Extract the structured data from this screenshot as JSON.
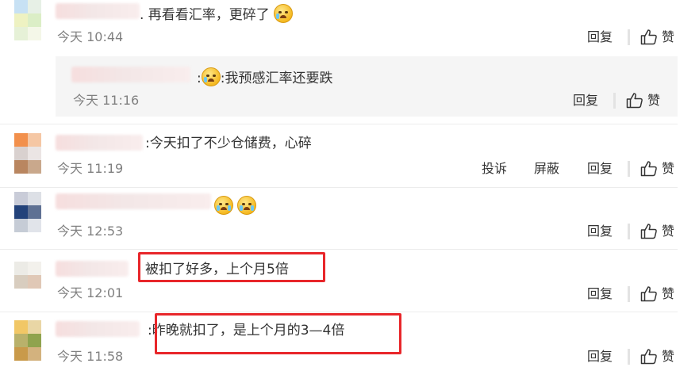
{
  "comments": [
    {
      "text": ". 再看看汇率，更碎了",
      "time": "今天 10:44",
      "reply": "回复",
      "like": "赞"
    },
    {
      "text": ":我预感汇率还要跌",
      "time": "今天 11:16",
      "reply": "回复",
      "like": "赞"
    },
    {
      "text": "今天扣了不少仓储费，心碎",
      "time": "今天 11:19",
      "report": "投诉",
      "block": "屏蔽",
      "reply": "回复",
      "like": "赞"
    },
    {
      "text": "",
      "time": "今天 12:53",
      "reply": "回复",
      "like": "赞"
    },
    {
      "text": "被扣了好多，上个月5倍",
      "time": "今天 12:01",
      "reply": "回复",
      "like": "赞"
    },
    {
      "text": ":昨晚就扣了，是上个月的3—4倍",
      "time": "今天 11:58",
      "reply": "回复",
      "like": "赞"
    }
  ],
  "colors": {
    "highlight": "#e8262a",
    "time": "#808080",
    "reply_bg": "#f5f5f5"
  },
  "icons": {
    "like": "thumbs-up-icon",
    "emoji_cry": "crying-emoji-icon"
  }
}
